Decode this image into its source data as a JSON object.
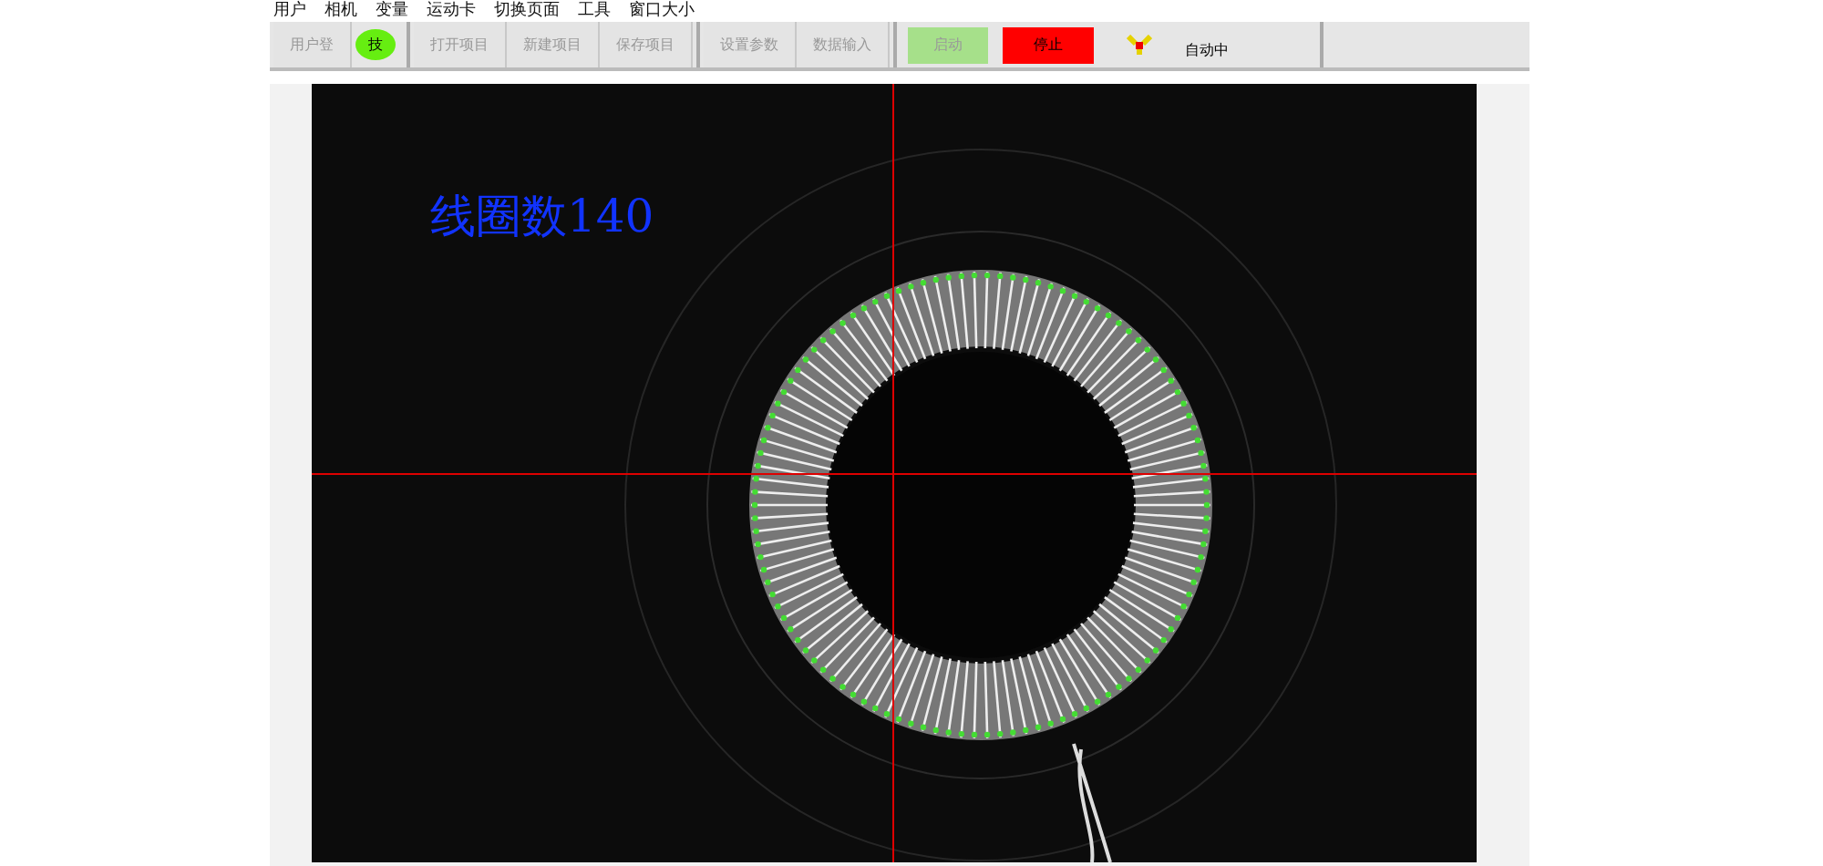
{
  "menu": [
    "用户",
    "相机",
    "变量",
    "运动卡",
    "切换页面",
    "工具",
    "窗口大小"
  ],
  "toolbar": {
    "groups": [
      [
        {
          "label": "用户登",
          "kind": "plain",
          "disabled": true,
          "badge": "技"
        }
      ],
      [
        {
          "label": "打开项目",
          "kind": "plain",
          "disabled": true
        },
        {
          "label": "新建项目",
          "kind": "plain",
          "disabled": true
        },
        {
          "label": "保存项目",
          "kind": "plain",
          "disabled": true
        }
      ],
      [
        {
          "label": "设置参数",
          "kind": "plain",
          "disabled": true
        },
        {
          "label": "数据输入",
          "kind": "plain",
          "disabled": true
        }
      ],
      [
        {
          "label": "启动",
          "kind": "start",
          "disabled": true
        },
        {
          "label": "停止",
          "kind": "stop",
          "disabled": false
        }
      ]
    ],
    "status": "自动中"
  },
  "view": {
    "overlay_text": "线圈数140"
  }
}
